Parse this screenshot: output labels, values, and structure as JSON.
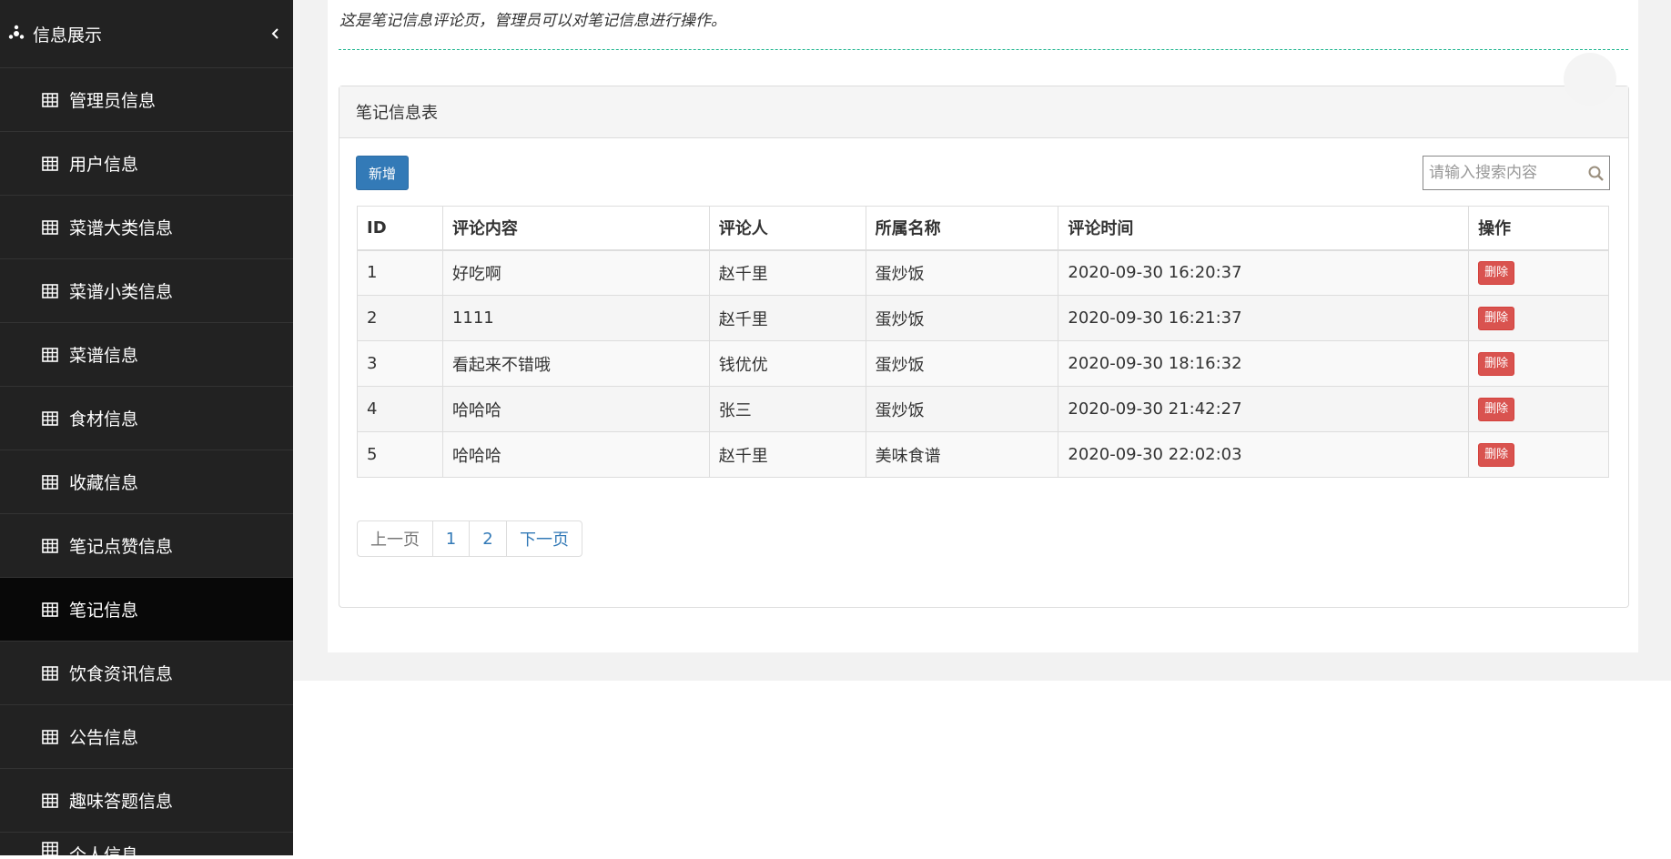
{
  "sidebar": {
    "section_title": "信息展示",
    "items": [
      {
        "label": "管理员信息"
      },
      {
        "label": "用户信息"
      },
      {
        "label": "菜谱大类信息"
      },
      {
        "label": "菜谱小类信息"
      },
      {
        "label": "菜谱信息"
      },
      {
        "label": "食材信息"
      },
      {
        "label": "收藏信息"
      },
      {
        "label": "笔记点赞信息"
      },
      {
        "label": "笔记信息",
        "active": true
      },
      {
        "label": "饮食资讯信息"
      },
      {
        "label": "公告信息"
      },
      {
        "label": "趣味答题信息"
      },
      {
        "label": "个人信息"
      }
    ]
  },
  "page": {
    "description": "这是笔记信息评论页，管理员可以对笔记信息进行操作。",
    "panel_title": "笔记信息表",
    "add_label": "新增",
    "search_placeholder": "请输入搜索内容"
  },
  "table": {
    "headers": [
      "ID",
      "评论内容",
      "评论人",
      "所属名称",
      "评论时间",
      "操作"
    ],
    "rows": [
      {
        "id": "1",
        "content": "好吃啊",
        "user": "赵千里",
        "name": "蛋炒饭",
        "time": "2020-09-30 16:20:37",
        "action": "删除"
      },
      {
        "id": "2",
        "content": "1111",
        "user": "赵千里",
        "name": "蛋炒饭",
        "time": "2020-09-30 16:21:37",
        "action": "删除"
      },
      {
        "id": "3",
        "content": "看起来不错哦",
        "user": "钱优优",
        "name": "蛋炒饭",
        "time": "2020-09-30 18:16:32",
        "action": "删除"
      },
      {
        "id": "4",
        "content": "哈哈哈",
        "user": "张三",
        "name": "蛋炒饭",
        "time": "2020-09-30 21:42:27",
        "action": "删除"
      },
      {
        "id": "5",
        "content": "哈哈哈",
        "user": "赵千里",
        "name": "美味食谱",
        "time": "2020-09-30 22:02:03",
        "action": "删除"
      }
    ]
  },
  "pagination": {
    "prev": "上一页",
    "pages": [
      "1",
      "2"
    ],
    "next": "下一页"
  },
  "colors": {
    "sidebar_bg": "#222222",
    "sidebar_active": "#080808",
    "primary": "#337ab7",
    "danger": "#d9534f",
    "divider": "#1fb58f"
  },
  "icons": {
    "section": "gear-icon",
    "collapse": "chevron-left-icon",
    "nav_item": "table-icon",
    "search": "search-icon"
  }
}
